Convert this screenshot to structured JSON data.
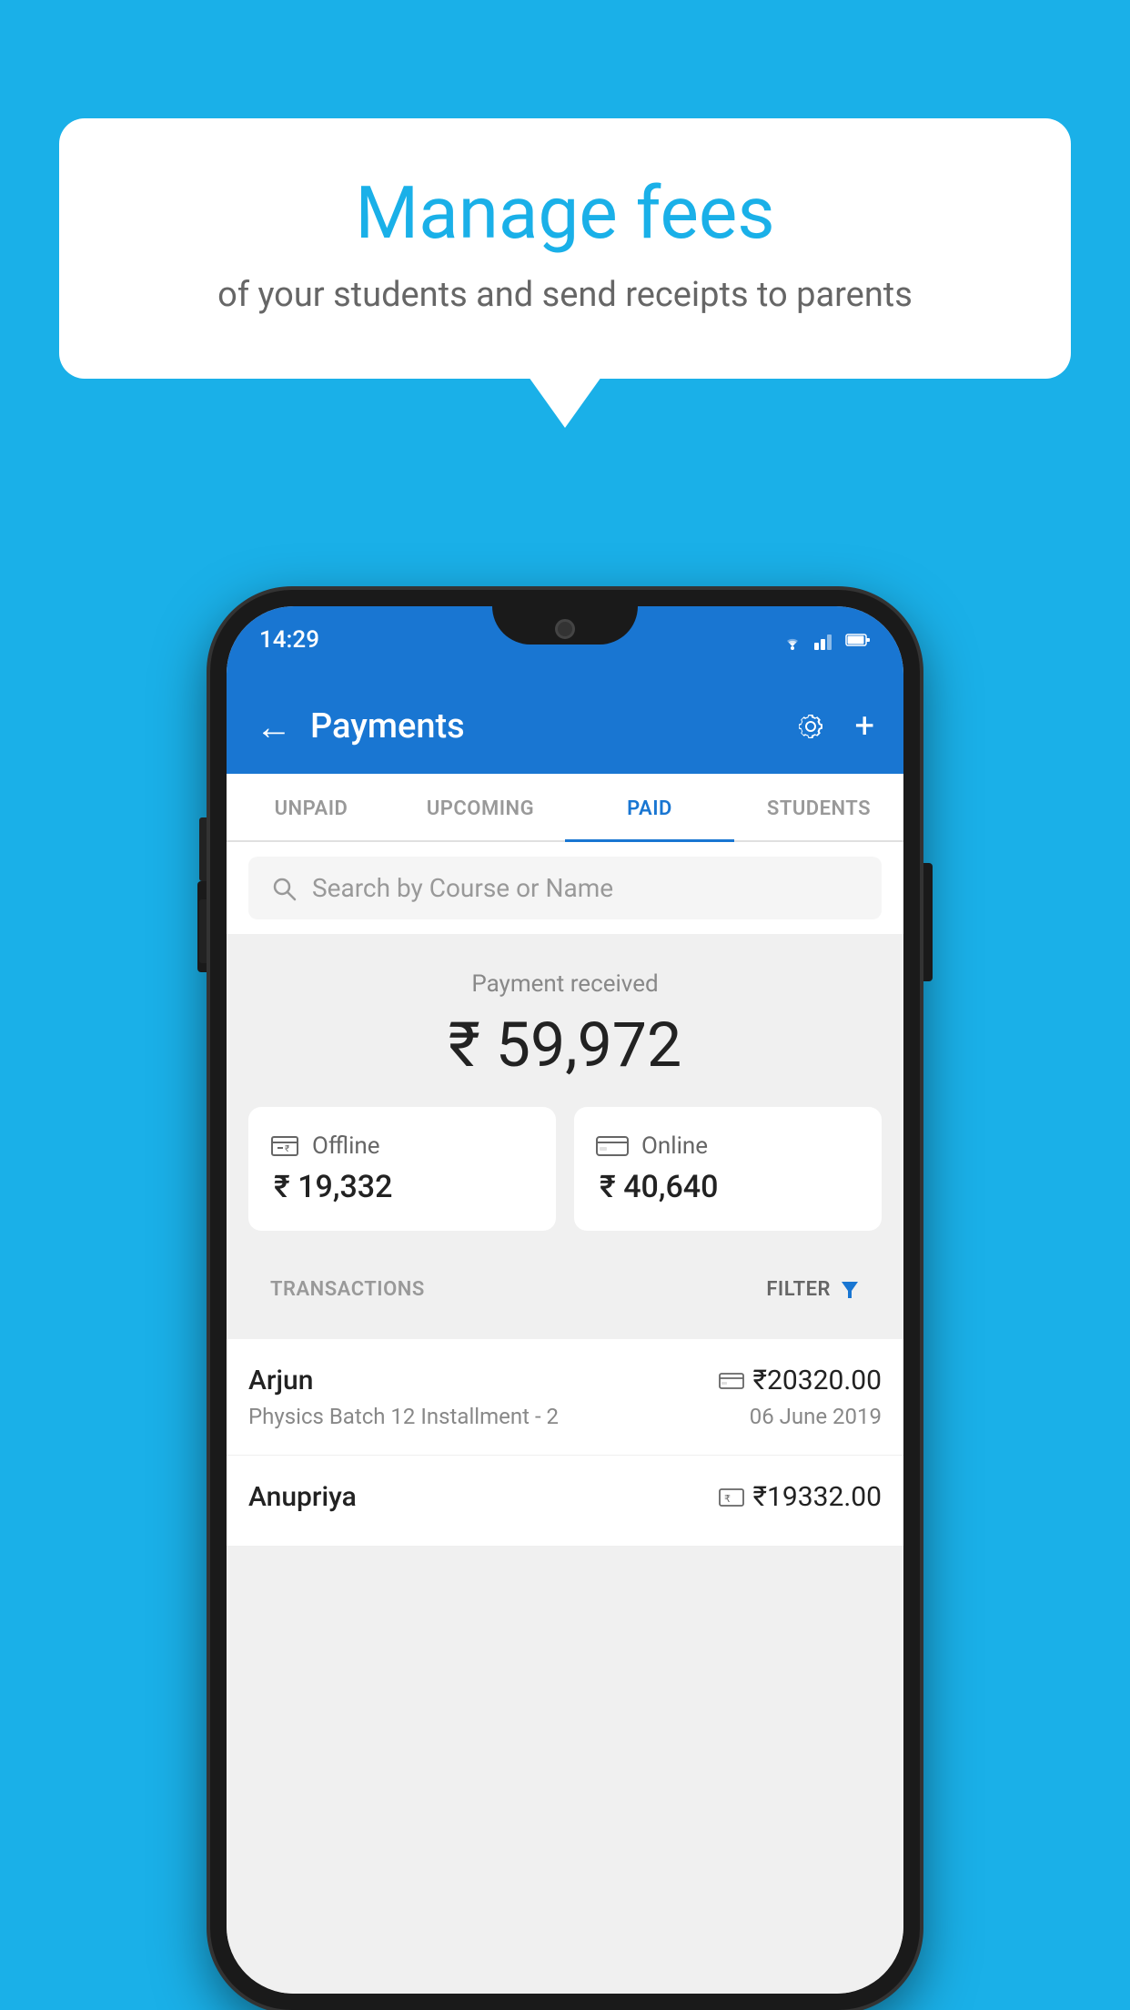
{
  "background_color": "#1ab0e8",
  "bubble": {
    "title": "Manage fees",
    "subtitle": "of your students and send receipts to parents"
  },
  "status_bar": {
    "time": "14:29",
    "icons": [
      "wifi",
      "signal",
      "battery"
    ]
  },
  "top_bar": {
    "back_label": "←",
    "title": "Payments",
    "settings_label": "⚙",
    "add_label": "+"
  },
  "tabs": [
    {
      "label": "UNPAID",
      "active": false
    },
    {
      "label": "UPCOMING",
      "active": false
    },
    {
      "label": "PAID",
      "active": true
    },
    {
      "label": "STUDENTS",
      "active": false
    }
  ],
  "search": {
    "placeholder": "Search by Course or Name"
  },
  "payment_summary": {
    "label": "Payment received",
    "amount": "₹ 59,972",
    "offline": {
      "type": "Offline",
      "amount": "₹ 19,332"
    },
    "online": {
      "type": "Online",
      "amount": "₹ 40,640"
    }
  },
  "transactions": {
    "section_label": "TRANSACTIONS",
    "filter_label": "FILTER",
    "items": [
      {
        "name": "Arjun",
        "amount": "₹20320.00",
        "payment_type": "online",
        "course": "Physics Batch 12 Installment - 2",
        "date": "06 June 2019"
      },
      {
        "name": "Anupriya",
        "amount": "₹19332.00",
        "payment_type": "offline",
        "course": "",
        "date": ""
      }
    ]
  }
}
